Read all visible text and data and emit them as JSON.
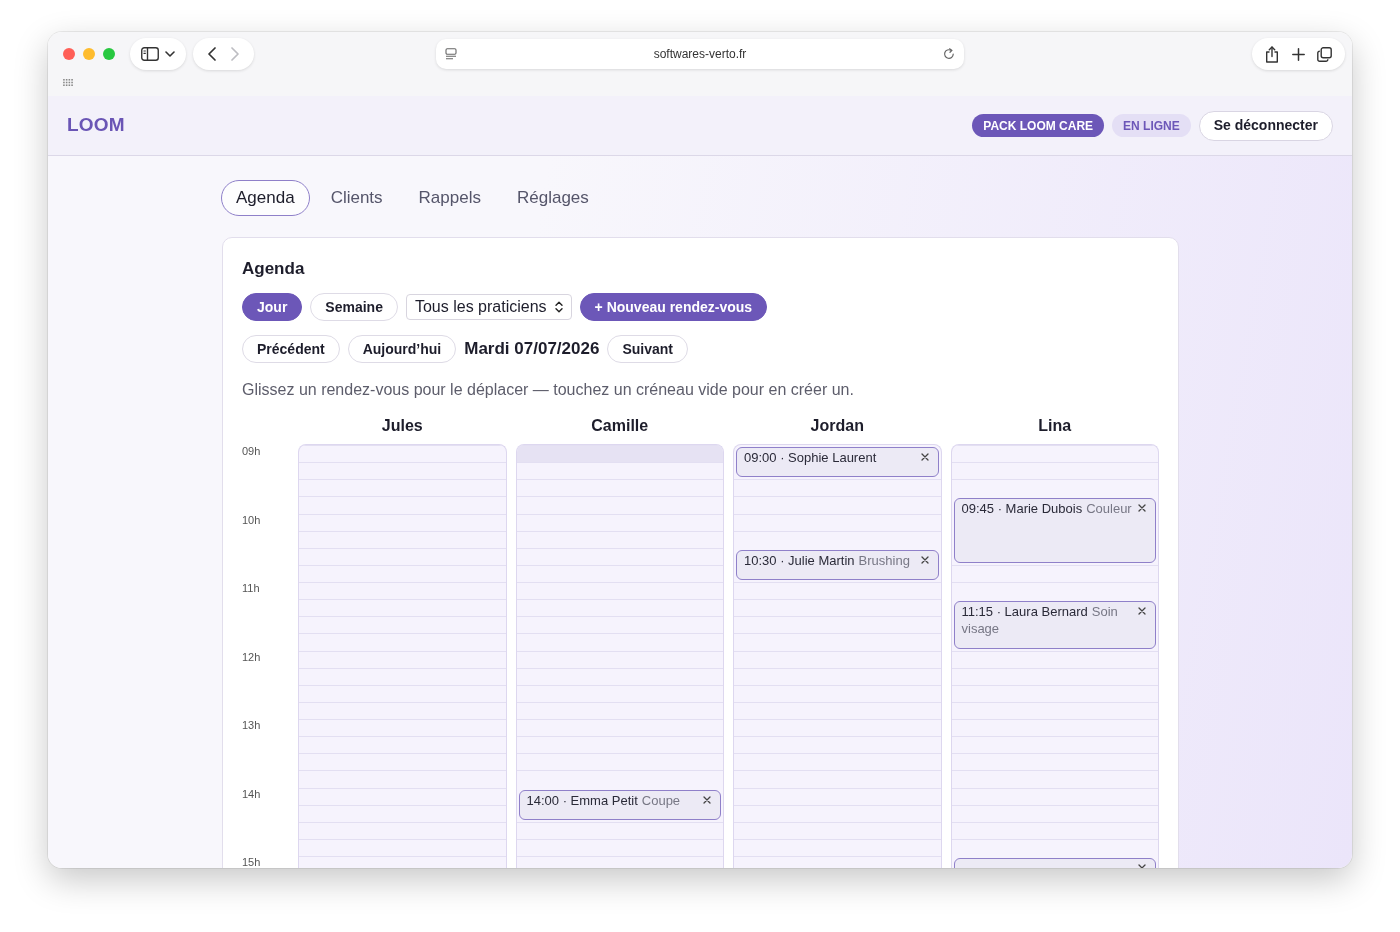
{
  "browser": {
    "url": "softwares-verto.fr",
    "back_disabled": false,
    "forward_disabled": true
  },
  "header": {
    "logo": "LOOM",
    "badges": [
      {
        "label": "PACK LOOM CARE",
        "kind": "plan"
      },
      {
        "label": "EN LIGNE",
        "kind": "status"
      }
    ],
    "logout": "Se déconnecter"
  },
  "tabs": [
    {
      "label": "Agenda",
      "selected": true
    },
    {
      "label": "Clients",
      "selected": false
    },
    {
      "label": "Rappels",
      "selected": false
    },
    {
      "label": "Réglages",
      "selected": false
    }
  ],
  "agenda": {
    "title": "Agenda",
    "views": [
      {
        "label": "Jour",
        "selected": true
      },
      {
        "label": "Semaine",
        "selected": false
      }
    ],
    "practitioner_select": {
      "value": "Tous les praticiens"
    },
    "new_appointment_button": "+ Nouveau rendez-vous",
    "previous_button": "Précédent",
    "today_button": "Aujourd’hui",
    "date": "Mardi 07/07/2026",
    "next_button": "Suivant",
    "hint": "Glissez un rendez-vous pour le déplacer — touchez un créneau vide pour en créer un.",
    "hours": [
      "09h",
      "10h",
      "11h",
      "12h",
      "13h",
      "14h",
      "15h"
    ],
    "columns": [
      {
        "name": "Jules",
        "slots": [
          {
            "kind": "free"
          },
          {
            "kind": "free"
          },
          {
            "kind": "free"
          },
          {
            "kind": "free"
          },
          {
            "kind": "free"
          },
          {
            "kind": "free"
          },
          {
            "kind": "free"
          },
          {
            "kind": "free"
          },
          {
            "kind": "free"
          },
          {
            "kind": "free"
          },
          {
            "kind": "free"
          },
          {
            "kind": "free"
          },
          {
            "kind": "free"
          },
          {
            "kind": "free"
          },
          {
            "kind": "free"
          },
          {
            "kind": "free"
          },
          {
            "kind": "free"
          },
          {
            "kind": "free"
          },
          {
            "kind": "free"
          },
          {
            "kind": "free"
          },
          {
            "kind": "free"
          },
          {
            "kind": "free"
          },
          {
            "kind": "free"
          },
          {
            "kind": "free"
          },
          {
            "kind": "free"
          }
        ]
      },
      {
        "name": "Camille",
        "slots": [
          {
            "kind": "hover"
          },
          {
            "kind": "free"
          },
          {
            "kind": "free"
          },
          {
            "kind": "free"
          },
          {
            "kind": "free"
          },
          {
            "kind": "free"
          },
          {
            "kind": "free"
          },
          {
            "kind": "free"
          },
          {
            "kind": "free"
          },
          {
            "kind": "free"
          },
          {
            "kind": "free"
          },
          {
            "kind": "free"
          },
          {
            "kind": "free"
          },
          {
            "kind": "free"
          },
          {
            "kind": "free"
          },
          {
            "kind": "free"
          },
          {
            "kind": "free"
          },
          {
            "kind": "free"
          },
          {
            "kind": "free"
          },
          {
            "kind": "free"
          },
          {
            "kind": "appointment",
            "title": "14:00 · Emma Petit",
            "service": "Coupe"
          },
          {
            "kind": "covered"
          },
          {
            "kind": "free"
          },
          {
            "kind": "free"
          },
          {
            "kind": "free"
          }
        ]
      },
      {
        "name": "Jordan",
        "slots": [
          {
            "kind": "appointment",
            "title": "09:00 · Sophie Laurent"
          },
          {
            "kind": "covered"
          },
          {
            "kind": "free"
          },
          {
            "kind": "free"
          },
          {
            "kind": "free"
          },
          {
            "kind": "free"
          },
          {
            "kind": "appointment",
            "title": "10:30 · Julie Martin",
            "service": "Brushing"
          },
          {
            "kind": "covered"
          },
          {
            "kind": "free"
          },
          {
            "kind": "free"
          },
          {
            "kind": "free"
          },
          {
            "kind": "free"
          },
          {
            "kind": "free"
          },
          {
            "kind": "free"
          },
          {
            "kind": "free"
          },
          {
            "kind": "free"
          },
          {
            "kind": "free"
          },
          {
            "kind": "free"
          },
          {
            "kind": "free"
          },
          {
            "kind": "free"
          },
          {
            "kind": "free"
          },
          {
            "kind": "free"
          },
          {
            "kind": "free"
          },
          {
            "kind": "free"
          },
          {
            "kind": "free"
          }
        ]
      },
      {
        "name": "Lina",
        "slots": [
          {
            "kind": "free"
          },
          {
            "kind": "free"
          },
          {
            "kind": "free"
          },
          {
            "kind": "appointment",
            "title": "09:45 · Marie Dubois",
            "service": "Couleur"
          },
          {
            "kind": "covered"
          },
          {
            "kind": "covered"
          },
          {
            "kind": "covered"
          },
          {
            "kind": "free"
          },
          {
            "kind": "free"
          },
          {
            "kind": "appointment",
            "title": "11:15 · Laura Bernard",
            "service": "Soin visage"
          },
          {
            "kind": "covered"
          },
          {
            "kind": "covered"
          },
          {
            "kind": "free"
          },
          {
            "kind": "free"
          },
          {
            "kind": "free"
          },
          {
            "kind": "free"
          },
          {
            "kind": "free"
          },
          {
            "kind": "free"
          },
          {
            "kind": "free"
          },
          {
            "kind": "free"
          },
          {
            "kind": "free"
          },
          {
            "kind": "free"
          },
          {
            "kind": "free"
          },
          {
            "kind": "free"
          },
          {
            "kind": "appointment"
          }
        ]
      }
    ]
  }
}
